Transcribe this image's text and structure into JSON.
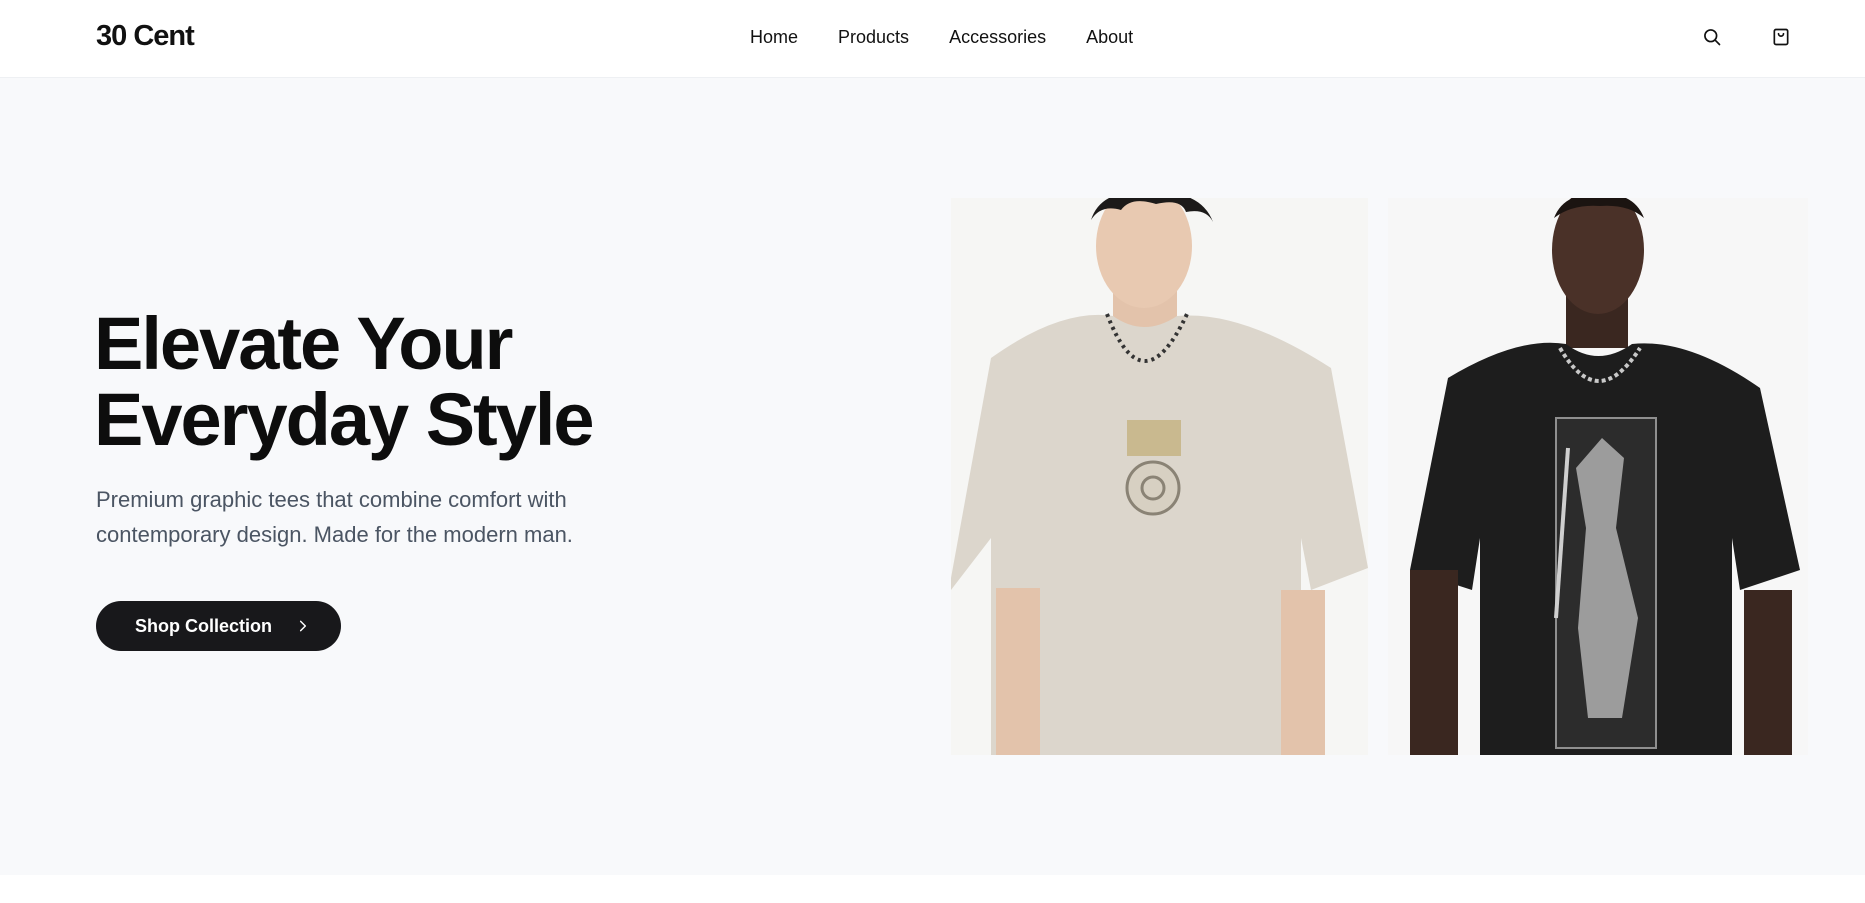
{
  "brand": {
    "name": "30 Cent"
  },
  "nav": {
    "links": [
      {
        "label": "Home"
      },
      {
        "label": "Products"
      },
      {
        "label": "Accessories"
      },
      {
        "label": "About"
      }
    ]
  },
  "icons": {
    "search": "search-icon",
    "cart": "shopping-bag-icon",
    "cta_arrow": "chevron-right-icon"
  },
  "hero": {
    "headline_line1": "Elevate Your",
    "headline_line2": "Everyday Style",
    "subtext": "Premium graphic tees that combine comfort with contemporary design. Made for the modern man.",
    "cta_label": "Shop Collection"
  },
  "colors": {
    "hero_bg": "#f8f9fb",
    "cta_bg": "#18181b",
    "text_primary": "#0d0d0d",
    "text_secondary": "#4b5563"
  }
}
